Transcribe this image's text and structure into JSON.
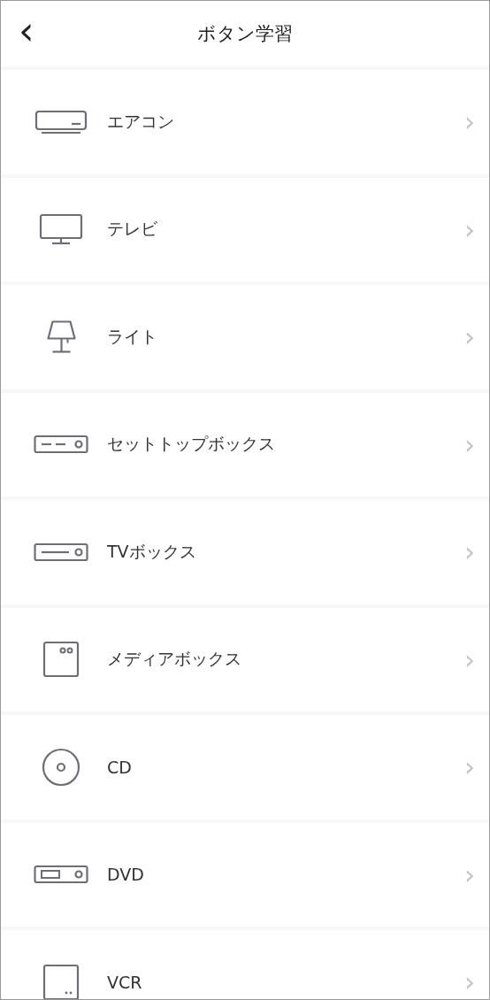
{
  "header": {
    "back": "‹",
    "title": "ボタン学習"
  },
  "items": [
    {
      "label": "エアコン",
      "chevron": "›"
    },
    {
      "label": "テレビ",
      "chevron": "›"
    },
    {
      "label": "ライト",
      "chevron": "›"
    },
    {
      "label": "セットトップボックス",
      "chevron": "›"
    },
    {
      "label": "TVボックス",
      "chevron": "›"
    },
    {
      "label": "メディアボックス",
      "chevron": "›"
    },
    {
      "label": "CD",
      "chevron": "›"
    },
    {
      "label": "DVD",
      "chevron": "›"
    },
    {
      "label": "VCR",
      "chevron": "›"
    }
  ]
}
